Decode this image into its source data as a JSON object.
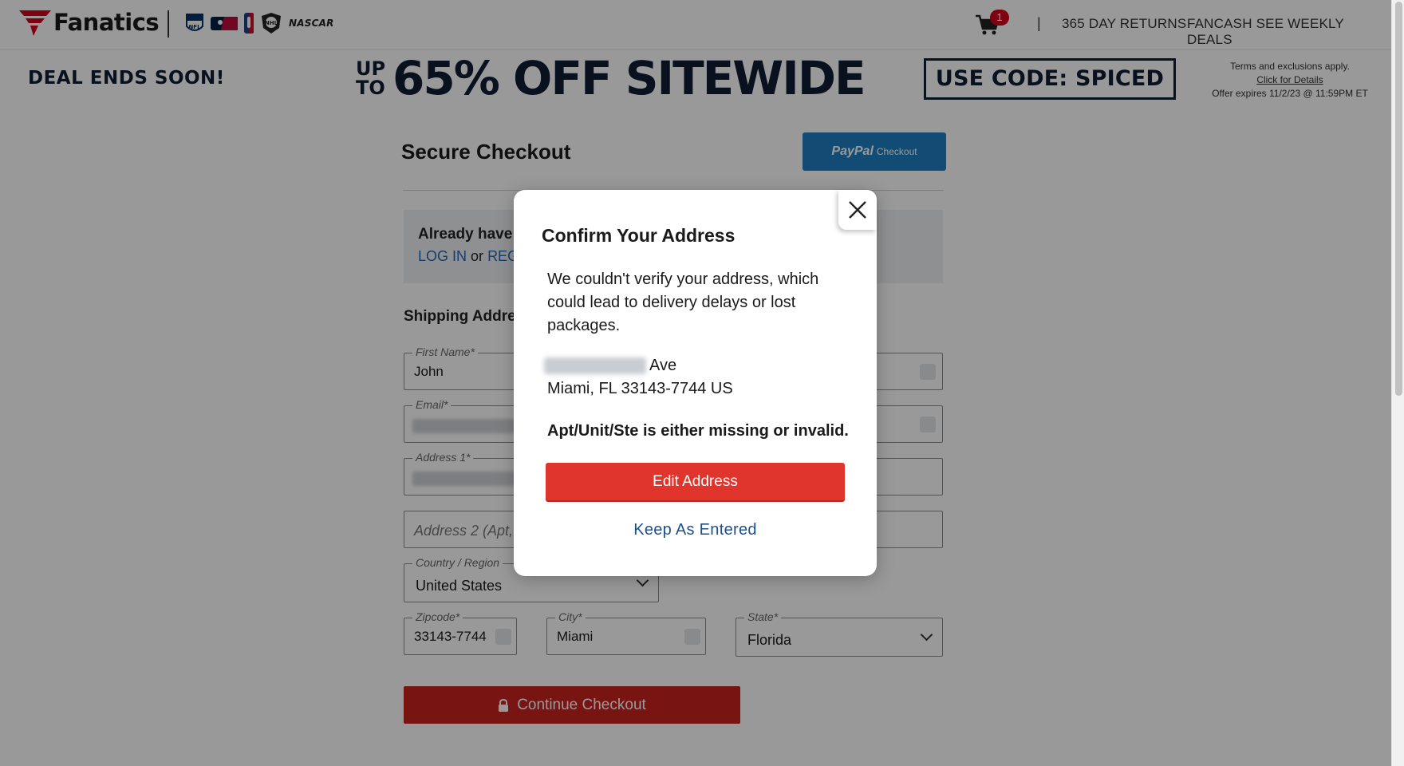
{
  "header": {
    "brand": "Fanatics",
    "league_logos": [
      "nfl-logo",
      "mlb-logo",
      "nba-logo",
      "nhl-logo"
    ],
    "nascar": "NASCAR",
    "cart_count": "1",
    "separator": "|",
    "nav": [
      "365 DAY RETURNS",
      "FANCASH SEE WEEKLY DEALS"
    ]
  },
  "promo": {
    "deal": "DEAL ENDS SOON!",
    "up": "UP",
    "to": "TO",
    "headline": "65% OFF SITEWIDE",
    "code": "USE CODE: SPICED",
    "terms_1": "Terms and exclusions apply.",
    "terms_link": "Click for Details",
    "terms_2": "Offer expires 11/2/23 @ 11:59PM ET"
  },
  "checkout": {
    "title": "Secure Checkout",
    "paypal": "PayPal",
    "paypal_sub": "Checkout",
    "already_have": "Already have a",
    "login": "LOG IN",
    "or": "or",
    "register": "REGI",
    "section": "Shipping Addres",
    "first_name_label": "First Name*",
    "first_name_value": "John",
    "email_label": "Email*",
    "address1_label": "Address 1*",
    "address2_placeholder": "Address 2 (Apt, ",
    "country_label": "Country / Region",
    "country_value": "United States",
    "zip_label": "Zipcode*",
    "zip_value": "33143-7744",
    "city_label": "City*",
    "city_value": "Miami",
    "state_label": "State*",
    "state_value": "Florida",
    "continue": "Continue Checkout"
  },
  "modal": {
    "title": "Confirm Your Address",
    "body": "We couldn't verify your address, which could lead to delivery delays or lost packages.",
    "street_suffix": "Ave",
    "city_line": "Miami, FL 33143-7744 US",
    "warning": "Apt/Unit/Ste is either missing or invalid.",
    "edit_button": "Edit Address",
    "keep_link": "Keep As Entered"
  },
  "colors": {
    "brand_red": "#c8221e",
    "modal_red": "#e0352c",
    "link_blue": "#1d4f8c",
    "paypal_blue": "#1f7fc2",
    "navy": "#0f1b33"
  }
}
